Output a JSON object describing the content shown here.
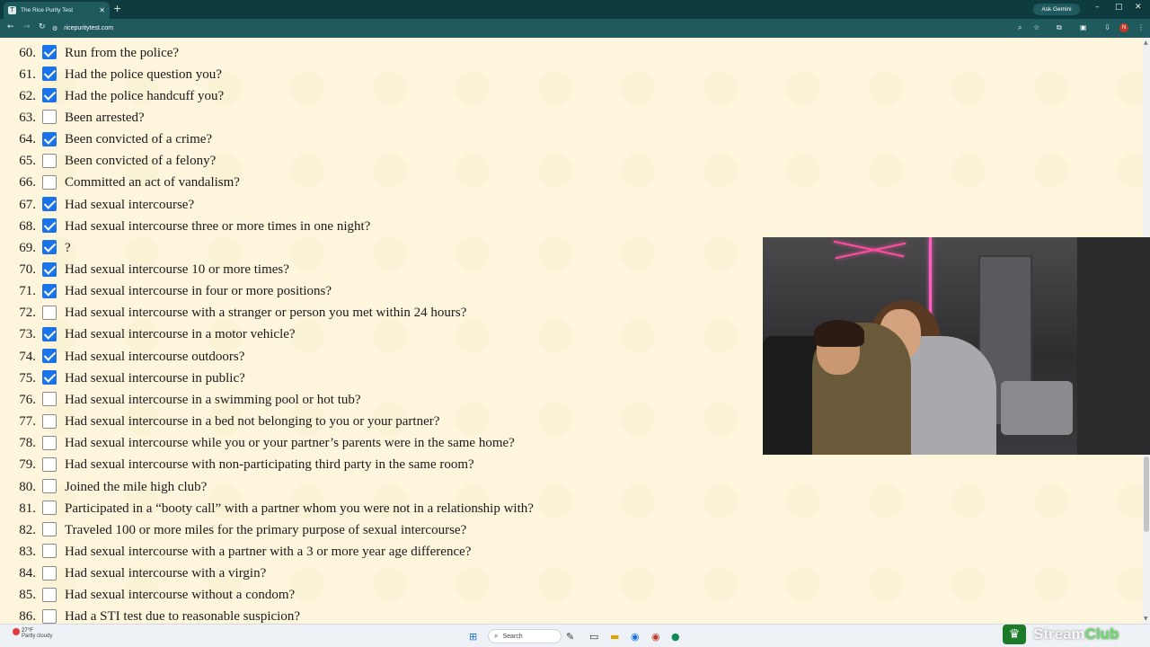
{
  "browser": {
    "tab_title": "The Rice Purity Test",
    "tab_favicon": "T",
    "ask_gemini": "Ask Gemini",
    "url": "ricepuritytest.com",
    "profile_initial": "N",
    "colors": {
      "chrome": "#0d3b3f",
      "toolbar": "#1f5a5e",
      "checkbox": "#1a73e8",
      "page_bg": "#fdf6dc"
    }
  },
  "questions": [
    {
      "num": "60.",
      "text": "Run from the police?",
      "checked": true
    },
    {
      "num": "61.",
      "text": "Had the police question you?",
      "checked": true
    },
    {
      "num": "62.",
      "text": "Had the police handcuff you?",
      "checked": true
    },
    {
      "num": "63.",
      "text": "Been arrested?",
      "checked": false
    },
    {
      "num": "64.",
      "text": "Been convicted of a crime?",
      "checked": true
    },
    {
      "num": "65.",
      "text": "Been convicted of a felony?",
      "checked": false
    },
    {
      "num": "66.",
      "text": "Committed an act of vandalism?",
      "checked": false
    },
    {
      "num": "67.",
      "text": "Had sexual intercourse?",
      "checked": true
    },
    {
      "num": "68.",
      "text": "Had sexual intercourse three or more times in one night?",
      "checked": true
    },
    {
      "num": "69.",
      "text": "?",
      "checked": true
    },
    {
      "num": "70.",
      "text": "Had sexual intercourse 10 or more times?",
      "checked": true
    },
    {
      "num": "71.",
      "text": "Had sexual intercourse in four or more positions?",
      "checked": true
    },
    {
      "num": "72.",
      "text": "Had sexual intercourse with a stranger or person you met within 24 hours?",
      "checked": false
    },
    {
      "num": "73.",
      "text": "Had sexual intercourse in a motor vehicle?",
      "checked": true
    },
    {
      "num": "74.",
      "text": "Had sexual intercourse outdoors?",
      "checked": true
    },
    {
      "num": "75.",
      "text": "Had sexual intercourse in public?",
      "checked": true
    },
    {
      "num": "76.",
      "text": "Had sexual intercourse in a swimming pool or hot tub?",
      "checked": false
    },
    {
      "num": "77.",
      "text": "Had sexual intercourse in a bed not belonging to you or your partner?",
      "checked": false
    },
    {
      "num": "78.",
      "text": "Had sexual intercourse while you or your partner’s parents were in the same home?",
      "checked": false
    },
    {
      "num": "79.",
      "text": "Had sexual intercourse with non-participating third party in the same room?",
      "checked": false
    },
    {
      "num": "80.",
      "text": "Joined the mile high club?",
      "checked": false
    },
    {
      "num": "81.",
      "text": "Participated in a “booty call” with a partner whom you were not in a relationship with?",
      "checked": false
    },
    {
      "num": "82.",
      "text": "Traveled 100 or more miles for the primary purpose of sexual intercourse?",
      "checked": false
    },
    {
      "num": "83.",
      "text": "Had sexual intercourse with a partner with a 3 or more year age difference?",
      "checked": false
    },
    {
      "num": "84.",
      "text": "Had sexual intercourse with a virgin?",
      "checked": false
    },
    {
      "num": "85.",
      "text": "Had sexual intercourse without a condom?",
      "checked": false
    },
    {
      "num": "86.",
      "text": "Had a STI test due to reasonable suspicion?",
      "checked": false
    }
  ],
  "taskbar": {
    "weather_temp": "27°F",
    "weather_condition": "Partly cloudy",
    "search_label": "Search"
  },
  "overlay": {
    "brand_part1": "Stream",
    "brand_part2": "Club"
  }
}
